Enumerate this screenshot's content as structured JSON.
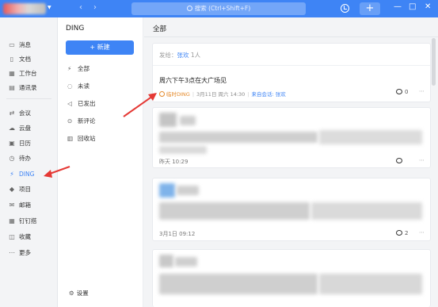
{
  "search": {
    "placeholder": "搜索 (Ctrl+Shift+F)"
  },
  "window": {
    "add_label": "+",
    "minimize_label": "—",
    "maximize_label": "□",
    "close_label": "✕"
  },
  "sidebar": {
    "items": [
      {
        "label": "消息",
        "icon": "chat-icon"
      },
      {
        "label": "文档",
        "icon": "document-icon"
      },
      {
        "label": "工作台",
        "icon": "grid-icon"
      },
      {
        "label": "通讯录",
        "icon": "contacts-icon"
      },
      {
        "label": "会议",
        "icon": "meeting-icon"
      },
      {
        "label": "云盘",
        "icon": "cloud-icon"
      },
      {
        "label": "日历",
        "icon": "calendar-icon"
      },
      {
        "label": "待办",
        "icon": "todo-icon"
      },
      {
        "label": "DING",
        "icon": "lightning-icon",
        "active": true
      },
      {
        "label": "项目",
        "icon": "project-icon"
      },
      {
        "label": "邮箱",
        "icon": "mail-icon"
      },
      {
        "label": "钉钉搭",
        "icon": "builder-icon"
      },
      {
        "label": "收藏",
        "icon": "favorite-icon"
      },
      {
        "label": "更多",
        "icon": "more-icon"
      }
    ]
  },
  "ding": {
    "title": "DING",
    "new_button": "+ 新建",
    "filters": [
      {
        "label": "全部",
        "icon": "lightning-icon",
        "active": true
      },
      {
        "label": "未读",
        "icon": "unread-icon"
      },
      {
        "label": "已发出",
        "icon": "send-icon"
      },
      {
        "label": "新评论",
        "icon": "comment-icon"
      },
      {
        "label": "回收站",
        "icon": "trash-icon"
      }
    ],
    "settings_label": "设置"
  },
  "main": {
    "title": "全部",
    "cards": [
      {
        "sender_prefix": "发给：",
        "sender_name": "张欢",
        "sender_count": "1人",
        "title": "周六下午3点在大广场见",
        "tag": "临时DING",
        "date": "3月11日 周六 14:30",
        "source": "来自会话: 张欢",
        "comments": "0"
      },
      {
        "time": "昨天 10:29"
      },
      {
        "time": "3月1日 09:12",
        "comments": "2"
      }
    ]
  },
  "colors": {
    "brand": "#3e84f5",
    "accent_orange": "#e58a2b",
    "arrow_red": "#e53935"
  }
}
